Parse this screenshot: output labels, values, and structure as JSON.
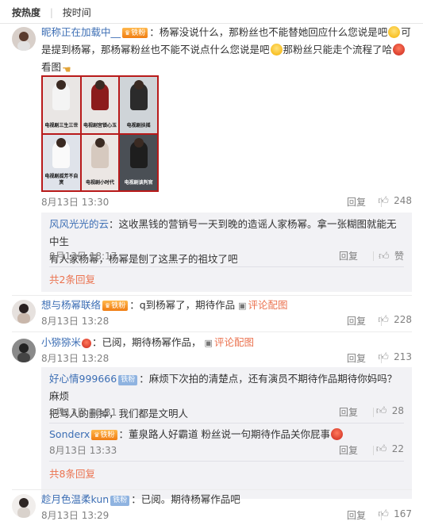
{
  "sort": {
    "hot": "按热度",
    "sep": "|",
    "time": "按时间"
  },
  "img_link_label": "评论配图",
  "reply_label": "回复",
  "c1": {
    "user": "昵称正在加载中__",
    "badge": "铁粉",
    "text1": "：杨幂没说什么，那粉丝也不能替她回应什么您说是吧",
    "text2": "可是提到杨幂，那杨幂粉丝也不能不说点什么您说是吧",
    "text3": "那粉丝只能走个流程了哈",
    "text4": "看图",
    "date": "8月13日 13:30",
    "likes": "248",
    "grid_captions": [
      "电视剧三生三世",
      "电视剧宫锁心玉",
      "电视剧扶摇",
      "电视剧孤芳不自赏",
      "电视剧小时代",
      "电视剧谈判官"
    ],
    "grid_subcaptions": [
      "",
      "",
      "",
      "",
      "",
      ""
    ]
  },
  "c1r1": {
    "user": "风风光光的云",
    "text1": "：这收黑钱的营销号一天到晚的造谣人家杨幂。拿一张糊图就能无中生",
    "text2": "有人家杨幂，杨幂是刨了这黑子的祖坟了吧",
    "date": "8月13日 18:17",
    "likes": "赞"
  },
  "c1more": "共2条回复",
  "c2": {
    "user": "想与杨幂联络",
    "badge": "铁粉",
    "text": "：q到杨幂了，期待作品",
    "date": "8月13日 13:28",
    "likes": "228"
  },
  "c3": {
    "user": "小猕猕米",
    "text": "：已阅，期待杨幂作品，",
    "date": "8月13日 13:28",
    "likes": "213"
  },
  "c3r1": {
    "user": "好心情999666",
    "badge": "铁粉",
    "text1": "：麻烦下次拍的清楚点，还有演员不期待作品期待你妈吗？麻烦",
    "text2": "把骂人的删掉，我们都是文明人",
    "date": "8月13日 13:31",
    "likes": "28"
  },
  "c3r2": {
    "user": "Sonderx",
    "badge": "铁粉",
    "text": "：董泉路人好霸道 粉丝说一句期待作品关你屁事",
    "date": "8月13日 13:33",
    "likes": "22"
  },
  "c3more": "共8条回复",
  "c4": {
    "user": "趁月色温柔kun",
    "badge": "铁粉",
    "text": "：已阅。期待杨幂作品吧",
    "date": "8月13日 13:29",
    "likes": "167"
  },
  "colors": {
    "accent": "#eb7350",
    "link": "#3c6eb4",
    "sub_bg": "#f2f2f5"
  }
}
